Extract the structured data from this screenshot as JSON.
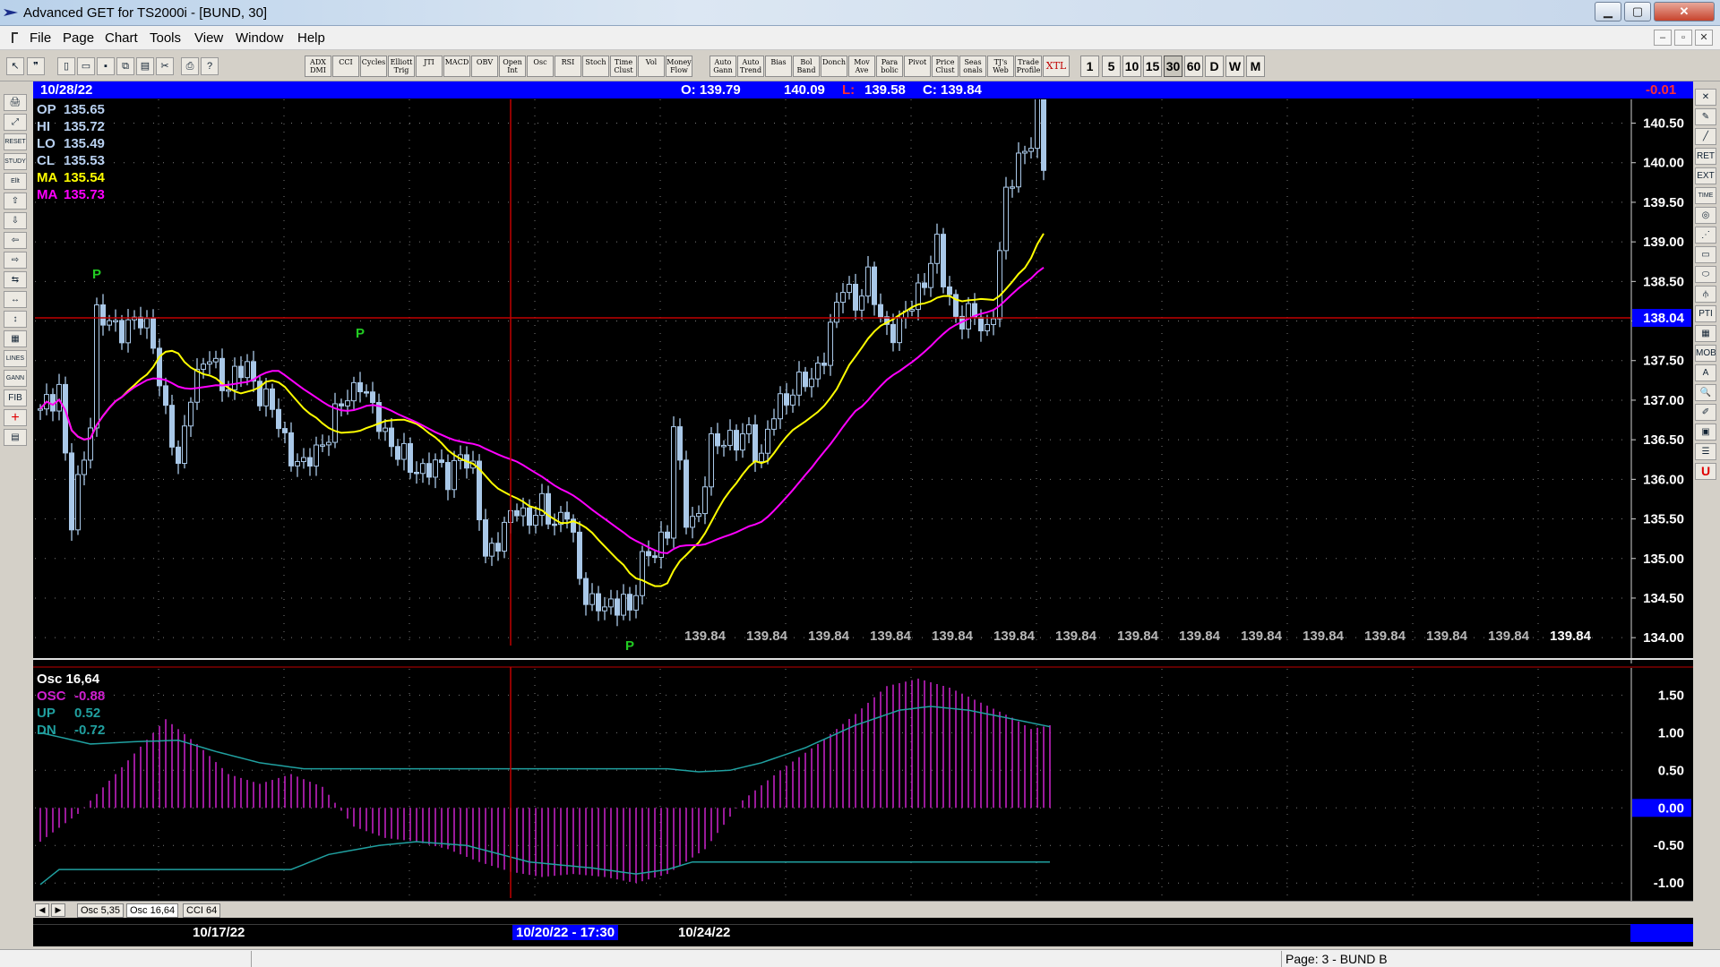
{
  "window": {
    "title": "Advanced GET for TS2000i - [BUND, 30]",
    "minimize_glyph": "▁",
    "maximize_glyph": "▢",
    "close_glyph": "✕",
    "mdi_buttons": [
      "–",
      "▫",
      "✕"
    ]
  },
  "menu": [
    "File",
    "Page",
    "Chart",
    "Tools",
    "View",
    "Window",
    "Help"
  ],
  "toolbar": {
    "file_icons": [
      "new-icon",
      "open-icon",
      "save-icon",
      "copy-icon",
      "paste-icon",
      "cut-icon",
      "print-icon",
      "help-icon"
    ],
    "study_buttons": [
      [
        "ADX",
        "DMI"
      ],
      [
        "CCI"
      ],
      [
        "Cycles"
      ],
      [
        "Elliott",
        "Trig"
      ],
      [
        "JTI"
      ],
      [
        "MACD"
      ],
      [
        "OBV"
      ],
      [
        "Open",
        "Int"
      ],
      [
        "Osc"
      ],
      [
        "RSI"
      ],
      [
        "Stoch"
      ],
      [
        "Time",
        "Clust"
      ],
      [
        "Vol"
      ],
      [
        "Money",
        "Flow"
      ]
    ],
    "tool_buttons": [
      [
        "Auto",
        "Gann"
      ],
      [
        "Auto",
        "Trend"
      ],
      [
        "Bias"
      ],
      [
        "Bol",
        "Band"
      ],
      [
        "Donch"
      ],
      [
        "Mov",
        "Ave"
      ],
      [
        "Para",
        "bolic"
      ],
      [
        "Pivot"
      ],
      [
        "Price",
        "Clust"
      ],
      [
        "Seas",
        "onals"
      ],
      [
        "TJ's",
        "Web"
      ],
      [
        "Trade",
        "Profile"
      ],
      [
        "XTL"
      ]
    ],
    "intervals": [
      "1",
      "5",
      "10",
      "15",
      "30",
      "60",
      "D",
      "W",
      "M"
    ],
    "active_interval": "30"
  },
  "info_bar": {
    "date": "10/28/22",
    "open": "O: 139.79",
    "high": "140.09",
    "low_label": "L:",
    "low": "139.58",
    "close": "C: 139.84",
    "change": "-0.01",
    "colors": {
      "bg": "#0000ff",
      "low_label": "#ff3030",
      "change": "#ff3030"
    }
  },
  "price_readout": {
    "op": {
      "label": "OP",
      "value": "135.65"
    },
    "hi": {
      "label": "HI",
      "value": "135.72"
    },
    "lo": {
      "label": "LO",
      "value": "135.49"
    },
    "cl": {
      "label": "CL",
      "value": "135.53"
    },
    "ma1": {
      "label": "MA",
      "value": "135.54",
      "color": "#ffff00"
    },
    "ma2": {
      "label": "MA",
      "value": "135.73",
      "color": "#ff00ff"
    }
  },
  "osc_readout": {
    "title": "Osc 16,64",
    "osc": {
      "label": "OSC",
      "value": "-0.88",
      "color": "#d020d0"
    },
    "up": {
      "label": "UP",
      "value": "0.52",
      "color": "#20a0a0"
    },
    "dn": {
      "label": "DN",
      "value": "-0.72",
      "color": "#20a0a0"
    }
  },
  "chart_data": [
    {
      "type": "candlestick",
      "symbol": "BUND",
      "interval": "30",
      "ylim": [
        133.9,
        140.8
      ],
      "yticks": [
        "140.50",
        "140.00",
        "139.50",
        "139.00",
        "138.50",
        "138.00",
        "137.50",
        "137.00",
        "136.50",
        "136.00",
        "135.50",
        "135.00",
        "134.50",
        "134.00"
      ],
      "crosshair_price": "138.04",
      "crosshair_value": 138.04,
      "crosshair_bar": 75,
      "pivot_marker": "P",
      "pivots": [
        {
          "bar": 9,
          "price": 138.45,
          "position": "above"
        },
        {
          "bar": 51,
          "price": 137.7,
          "position": "above"
        },
        {
          "bar": 94,
          "price": 134.0,
          "position": "below"
        }
      ],
      "bottom_price_labels": [
        "139.84",
        "139.84",
        "139.84",
        "139.84",
        "139.84",
        "139.84",
        "139.84",
        "139.84",
        "139.84",
        "139.84",
        "139.84",
        "139.84",
        "139.84",
        "139.84",
        "139.84"
      ],
      "anchors": [
        [
          0,
          136.8
        ],
        [
          3,
          137.2
        ],
        [
          5,
          135.4
        ],
        [
          8,
          136.8
        ],
        [
          9,
          138.1
        ],
        [
          11,
          137.9
        ],
        [
          15,
          138.0
        ],
        [
          18,
          137.8
        ],
        [
          20,
          136.8
        ],
        [
          22,
          136.1
        ],
        [
          24,
          137.2
        ],
        [
          27,
          137.5
        ],
        [
          30,
          137.2
        ],
        [
          33,
          137.4
        ],
        [
          36,
          137.0
        ],
        [
          39,
          136.5
        ],
        [
          42,
          136.1
        ],
        [
          45,
          136.5
        ],
        [
          48,
          136.9
        ],
        [
          51,
          137.3
        ],
        [
          53,
          136.8
        ],
        [
          56,
          136.5
        ],
        [
          59,
          136.1
        ],
        [
          62,
          136.2
        ],
        [
          65,
          136.0
        ],
        [
          67,
          136.4
        ],
        [
          69,
          136.0
        ],
        [
          71,
          135.1
        ],
        [
          74,
          135.3
        ],
        [
          76,
          135.7
        ],
        [
          78,
          135.5
        ],
        [
          80,
          135.6
        ],
        [
          82,
          135.5
        ],
        [
          84,
          135.6
        ],
        [
          86,
          134.7
        ],
        [
          89,
          134.4
        ],
        [
          91,
          134.3
        ],
        [
          93,
          134.6
        ],
        [
          94,
          134.3
        ],
        [
          96,
          134.9
        ],
        [
          98,
          135.2
        ],
        [
          100,
          135.3
        ],
        [
          101,
          136.6
        ],
        [
          103,
          135.6
        ],
        [
          105,
          135.5
        ],
        [
          107,
          136.4
        ],
        [
          109,
          136.6
        ],
        [
          111,
          136.4
        ],
        [
          113,
          136.6
        ],
        [
          115,
          136.3
        ],
        [
          117,
          136.8
        ],
        [
          120,
          137.2
        ],
        [
          123,
          137.2
        ],
        [
          126,
          137.9
        ],
        [
          128,
          138.4
        ],
        [
          130,
          138.3
        ],
        [
          132,
          138.5
        ],
        [
          134,
          138.0
        ],
        [
          137,
          137.9
        ],
        [
          139,
          138.2
        ],
        [
          141,
          138.6
        ],
        [
          143,
          138.9
        ],
        [
          144,
          138.5
        ],
        [
          146,
          138.1
        ],
        [
          149,
          138.0
        ],
        [
          151,
          137.9
        ],
        [
          152,
          138.2
        ],
        [
          154,
          139.5
        ],
        [
          156,
          140.1
        ],
        [
          158,
          140.3
        ],
        [
          159,
          140.6
        ],
        [
          160,
          139.9
        ]
      ],
      "ma_fast_color": "#ffff00",
      "ma_slow_color": "#ff00ff"
    },
    {
      "type": "oscillator",
      "title": "Osc 16,64",
      "ylim": [
        -1.2,
        1.85
      ],
      "yticks": [
        "1.50",
        "1.00",
        "0.50",
        "0.00",
        "-0.50",
        "-1.00"
      ],
      "zero_label": "0.00",
      "osc_anchors": [
        [
          0,
          -0.45
        ],
        [
          6,
          -0.08
        ],
        [
          12,
          0.45
        ],
        [
          20,
          1.18
        ],
        [
          25,
          0.85
        ],
        [
          30,
          0.45
        ],
        [
          35,
          0.32
        ],
        [
          40,
          0.45
        ],
        [
          45,
          0.28
        ],
        [
          50,
          -0.25
        ],
        [
          55,
          -0.4
        ],
        [
          60,
          -0.45
        ],
        [
          65,
          -0.55
        ],
        [
          70,
          -0.72
        ],
        [
          75,
          -0.85
        ],
        [
          80,
          -0.92
        ],
        [
          85,
          -0.88
        ],
        [
          90,
          -0.92
        ],
        [
          95,
          -1.0
        ],
        [
          100,
          -0.88
        ],
        [
          106,
          -0.55
        ],
        [
          112,
          0.1
        ],
        [
          118,
          0.5
        ],
        [
          124,
          0.85
        ],
        [
          130,
          1.25
        ],
        [
          135,
          1.62
        ],
        [
          140,
          1.72
        ],
        [
          145,
          1.6
        ],
        [
          150,
          1.4
        ],
        [
          155,
          1.2
        ],
        [
          158,
          1.05
        ],
        [
          161,
          1.1
        ]
      ],
      "up_anchors": [
        [
          0,
          1.0
        ],
        [
          8,
          0.85
        ],
        [
          15,
          0.88
        ],
        [
          22,
          0.9
        ],
        [
          28,
          0.75
        ],
        [
          35,
          0.6
        ],
        [
          42,
          0.52
        ],
        [
          100,
          0.52
        ],
        [
          105,
          0.48
        ],
        [
          110,
          0.5
        ],
        [
          115,
          0.6
        ],
        [
          122,
          0.8
        ],
        [
          130,
          1.1
        ],
        [
          137,
          1.3
        ],
        [
          142,
          1.35
        ],
        [
          148,
          1.3
        ],
        [
          154,
          1.2
        ],
        [
          161,
          1.08
        ]
      ],
      "dn_anchors": [
        [
          0,
          -1.02
        ],
        [
          3,
          -0.82
        ],
        [
          40,
          -0.82
        ],
        [
          46,
          -0.62
        ],
        [
          54,
          -0.5
        ],
        [
          60,
          -0.45
        ],
        [
          68,
          -0.5
        ],
        [
          78,
          -0.72
        ],
        [
          88,
          -0.8
        ],
        [
          95,
          -0.88
        ],
        [
          100,
          -0.82
        ],
        [
          104,
          -0.72
        ],
        [
          161,
          -0.72
        ]
      ],
      "osc_color": "#c020c0",
      "band_color": "#20a0a0"
    }
  ],
  "tabs": [
    "Osc 5,35",
    "Osc 16,64",
    "CCI 64"
  ],
  "active_tab": "Osc 16,64",
  "dates": {
    "first": "10/17/22",
    "highlight": "10/20/22 - 17:30",
    "second": "10/24/22"
  },
  "statusbar": {
    "page": "Page: 3 - BUND B"
  },
  "left_tools": [
    {
      "name": "print-chart-icon",
      "glyph": "🖨"
    },
    {
      "name": "zoom-in-icon",
      "glyph": "⤢"
    },
    {
      "name": "reset-icon",
      "glyph": "RESET"
    },
    {
      "name": "study-icon",
      "glyph": "STUDY"
    },
    {
      "name": "elliott-icon",
      "glyph": "Ellt"
    },
    {
      "name": "arrow-up-icon",
      "glyph": "⇧"
    },
    {
      "name": "arrow-down-icon",
      "glyph": "⇩"
    },
    {
      "name": "arrow-left-icon",
      "glyph": "⇦"
    },
    {
      "name": "arrow-right-icon",
      "glyph": "⇨"
    },
    {
      "name": "compress-icon",
      "glyph": "⇆"
    },
    {
      "name": "expand-h-icon",
      "glyph": "↔"
    },
    {
      "name": "expand-v-icon",
      "glyph": "↕"
    },
    {
      "name": "grid-icon",
      "glyph": "▦"
    },
    {
      "name": "lines-icon",
      "glyph": "LINES"
    },
    {
      "name": "gann-icon",
      "glyph": "GANN"
    },
    {
      "name": "fib-icon",
      "glyph": "FIB"
    },
    {
      "name": "crosshair-icon",
      "glyph": "+"
    },
    {
      "name": "data-window-icon",
      "glyph": "▤"
    }
  ],
  "right_tools": [
    {
      "name": "close-tool-icon",
      "glyph": "✕"
    },
    {
      "name": "pencil-icon",
      "glyph": "✎"
    },
    {
      "name": "trendline-icon",
      "glyph": "╱"
    },
    {
      "name": "fib-ret-icon",
      "glyph": "RET"
    },
    {
      "name": "fib-ext-icon",
      "glyph": "EXT"
    },
    {
      "name": "fib-time-icon",
      "glyph": "TIME"
    },
    {
      "name": "arc-icon",
      "glyph": "◎"
    },
    {
      "name": "fan-icon",
      "glyph": "⋰"
    },
    {
      "name": "channel-icon",
      "glyph": "▭"
    },
    {
      "name": "ellipse-icon",
      "glyph": "⬭"
    },
    {
      "name": "pitchfork-icon",
      "glyph": "⫛"
    },
    {
      "name": "pti-icon",
      "glyph": "PTI"
    },
    {
      "name": "matrix-icon",
      "glyph": "▦"
    },
    {
      "name": "mob-icon",
      "glyph": "MOB"
    },
    {
      "name": "text-icon",
      "glyph": "A"
    },
    {
      "name": "magnifier-icon",
      "glyph": "🔍"
    },
    {
      "name": "marker-icon",
      "glyph": "✐"
    },
    {
      "name": "calculator-icon",
      "glyph": "▣"
    },
    {
      "name": "notes-icon",
      "glyph": "☰"
    },
    {
      "name": "u-tool-icon",
      "glyph": "U"
    }
  ]
}
